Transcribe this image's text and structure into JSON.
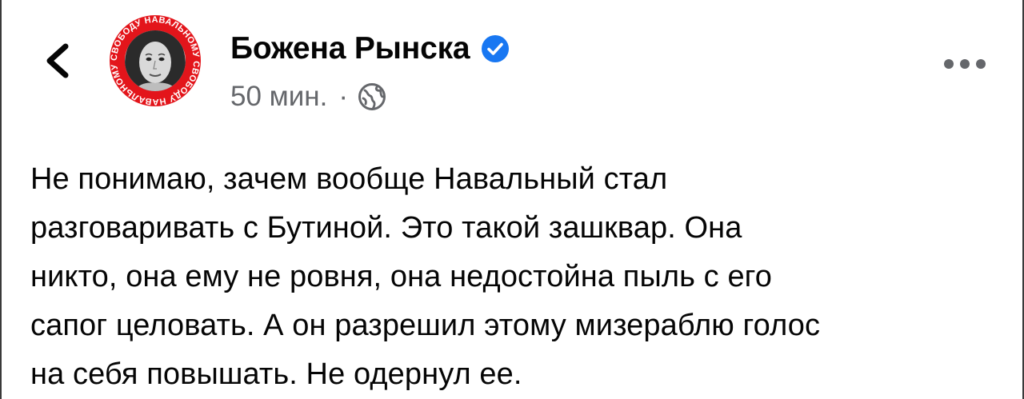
{
  "colors": {
    "primary_text": "#050505",
    "secondary_text": "#65676b",
    "verified_blue": "#1877f2",
    "avatar_ring_red": "#e3151b"
  },
  "header": {
    "back_icon": "chevron-left-icon",
    "author_name": "Божена Рынска",
    "verified_icon": "verified-badge-icon",
    "time_ago": "50 мин.",
    "separator": "·",
    "audience_icon": "globe-icon",
    "more_icon": "more-horizontal-icon"
  },
  "avatar": {
    "ring_text": "СВОБОДУ НАВАЛЬНОМУ СВОБОДУ НАВАЛЬНОМУ"
  },
  "post": {
    "lines": [
      "Не понимаю, зачем вообще Навальный стал",
      "разговаривать с Бутиной. Это такой зашквар. Она",
      "никто, она ему не ровня, она недостойна пыль с его",
      "сапог целовать. А он разрешил этому мизераблю голос",
      "на себя повышать. Не одернул ее."
    ]
  }
}
